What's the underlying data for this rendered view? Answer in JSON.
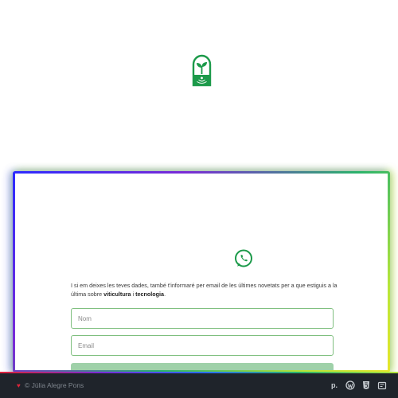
{
  "colors": {
    "brand_green": "#1c9a4a",
    "field_border": "#7fbf7f",
    "button_bg": "#9fd1a9",
    "footer_bg": "#1f242b",
    "heart": "#e0243a"
  },
  "logo": {
    "icon": "sprout-arch-logo-icon"
  },
  "newsletter": {
    "whatsapp_icon": "whatsapp-icon",
    "intro_prefix": "I si em deixes les teves dades, també t'informaré per email de les últimes novetats per a que estiguis a la última sobre ",
    "topic_1": "viticultura",
    "joiner": " i ",
    "topic_2": "tecnologia",
    "suffix": ".",
    "name_placeholder": "Nom",
    "email_placeholder": "Email"
  },
  "footer": {
    "copyright": "© Júlia Alegre Pons",
    "icons": [
      "p-icon",
      "wordpress-icon",
      "html5-icon",
      "pages-icon"
    ]
  }
}
